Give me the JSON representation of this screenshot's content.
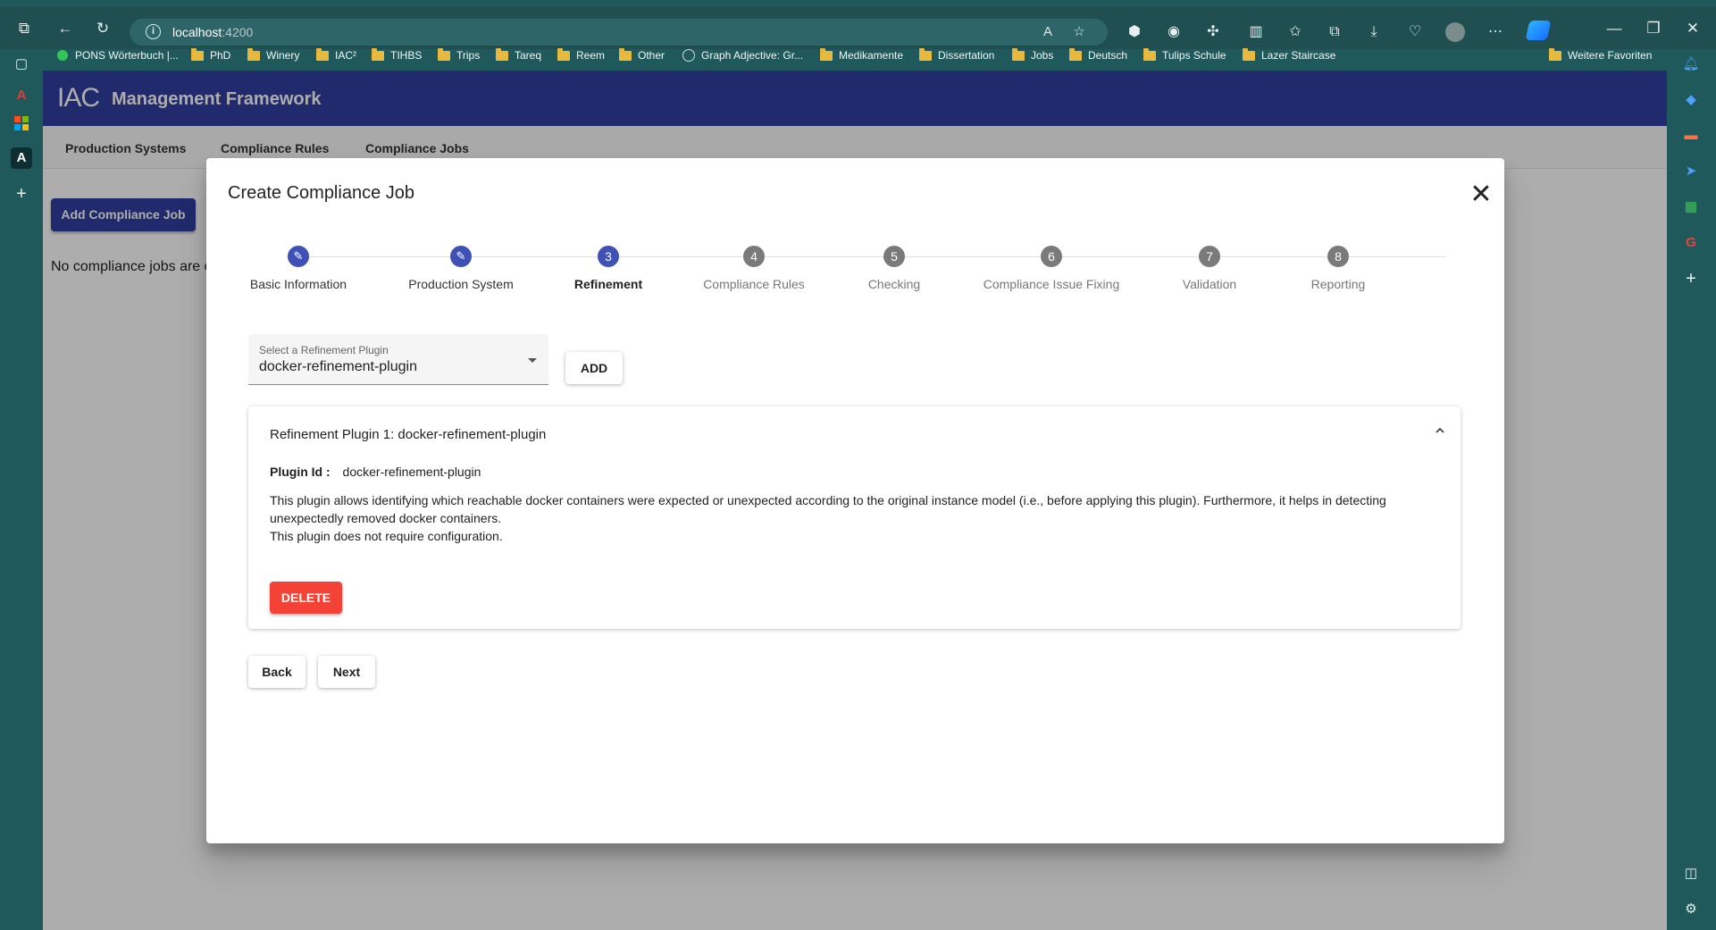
{
  "browser": {
    "url_host": "localhost",
    "url_port": ":4200",
    "bookmarks": [
      "PONS Wörterbuch |...",
      "PhD",
      "Winery",
      "IAC²",
      "TIHBS",
      "Trips",
      "Tareq",
      "Reem",
      "Other",
      "Graph Adjective: Gr...",
      "Medikamente",
      "Dissertation",
      "Jobs",
      "Deutsch",
      "Tulips Schule",
      "Lazer Staircase",
      "Weitere Favoriten"
    ]
  },
  "app": {
    "logo": "IAC",
    "title": "Management Framework",
    "nav": [
      "Production Systems",
      "Compliance Rules",
      "Compliance Jobs"
    ],
    "add_job_label": "Add Compliance Job",
    "empty_text": "No compliance jobs are c"
  },
  "dialog": {
    "title": "Create Compliance Job",
    "close_icon": "✕",
    "steps": [
      {
        "label": "Basic Information",
        "marker": "✎",
        "state": "done"
      },
      {
        "label": "Production System",
        "marker": "✎",
        "state": "done"
      },
      {
        "label": "Refinement",
        "marker": "3",
        "state": "active"
      },
      {
        "label": "Compliance Rules",
        "marker": "4",
        "state": "todo"
      },
      {
        "label": "Checking",
        "marker": "5",
        "state": "todo"
      },
      {
        "label": "Compliance Issue Fixing",
        "marker": "6",
        "state": "todo"
      },
      {
        "label": "Validation",
        "marker": "7",
        "state": "todo"
      },
      {
        "label": "Reporting",
        "marker": "8",
        "state": "todo"
      }
    ],
    "select_label": "Select a Refinement Plugin",
    "select_value": "docker-refinement-plugin",
    "add_label": "ADD",
    "panel": {
      "title": "Refinement Plugin 1: docker-refinement-plugin",
      "plugin_id_label": "Plugin Id :",
      "plugin_id_value": "docker-refinement-plugin",
      "desc_line1": "This plugin allows identifying which reachable docker containers were expected or unexpected according to the original instance model (i.e., before applying this plugin). Furthermore, it helps in detecting",
      "desc_line2": "unexpectedly removed docker containers.",
      "desc_line3": "This plugin does not require configuration.",
      "delete_label": "DELETE"
    },
    "back_label": "Back",
    "next_label": "Next"
  },
  "colors": {
    "primary": "#303f9f",
    "step_active": "#3f51b5",
    "delete": "#f44336",
    "chrome": "#20595c"
  }
}
